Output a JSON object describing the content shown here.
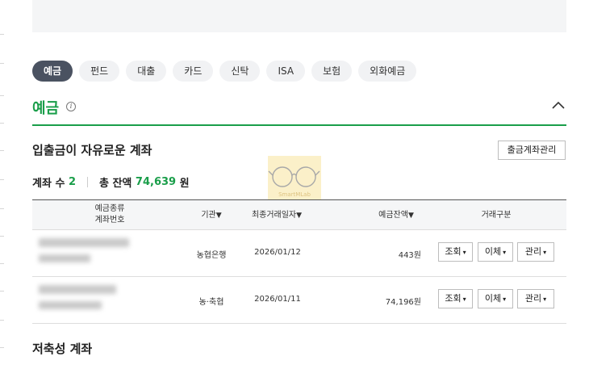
{
  "tabs": [
    {
      "label": "예금",
      "active": true
    },
    {
      "label": "펀드",
      "active": false
    },
    {
      "label": "대출",
      "active": false
    },
    {
      "label": "카드",
      "active": false
    },
    {
      "label": "신탁",
      "active": false
    },
    {
      "label": "ISA",
      "active": false
    },
    {
      "label": "보험",
      "active": false
    },
    {
      "label": "외화예금",
      "active": false
    }
  ],
  "section": {
    "title": "예금",
    "info_icon": "info-icon",
    "collapse_icon": "chevron-up-icon"
  },
  "demand": {
    "title": "입출금이 자유로운 계좌",
    "manage_button": "출금계좌관리",
    "count_label": "계좌 수",
    "count_value": "2",
    "balance_label": "총 잔액",
    "balance_value": "74,639",
    "balance_unit": "원"
  },
  "watermark": {
    "text": "SmartMLab"
  },
  "table": {
    "headers": {
      "product_line1": "예금종류",
      "product_line2": "계좌번호",
      "bank": "기관",
      "last_date": "최종거래일자",
      "balance": "예금잔액",
      "action": "거래구분"
    },
    "sort_arrow": "▼",
    "rows": [
      {
        "bank": "농협은행",
        "date": "2026/01/12",
        "balance": "443원",
        "actions": [
          "조회",
          "이체",
          "관리"
        ]
      },
      {
        "bank": "농·축협",
        "date": "2026/01/11",
        "balance": "74,196원",
        "actions": [
          "조회",
          "이체",
          "관리"
        ]
      }
    ],
    "chevron": "▾"
  },
  "savings": {
    "title": "저축성 계좌"
  },
  "colors": {
    "accent_green": "#1a9e4a",
    "tab_active": "#4a5261"
  }
}
